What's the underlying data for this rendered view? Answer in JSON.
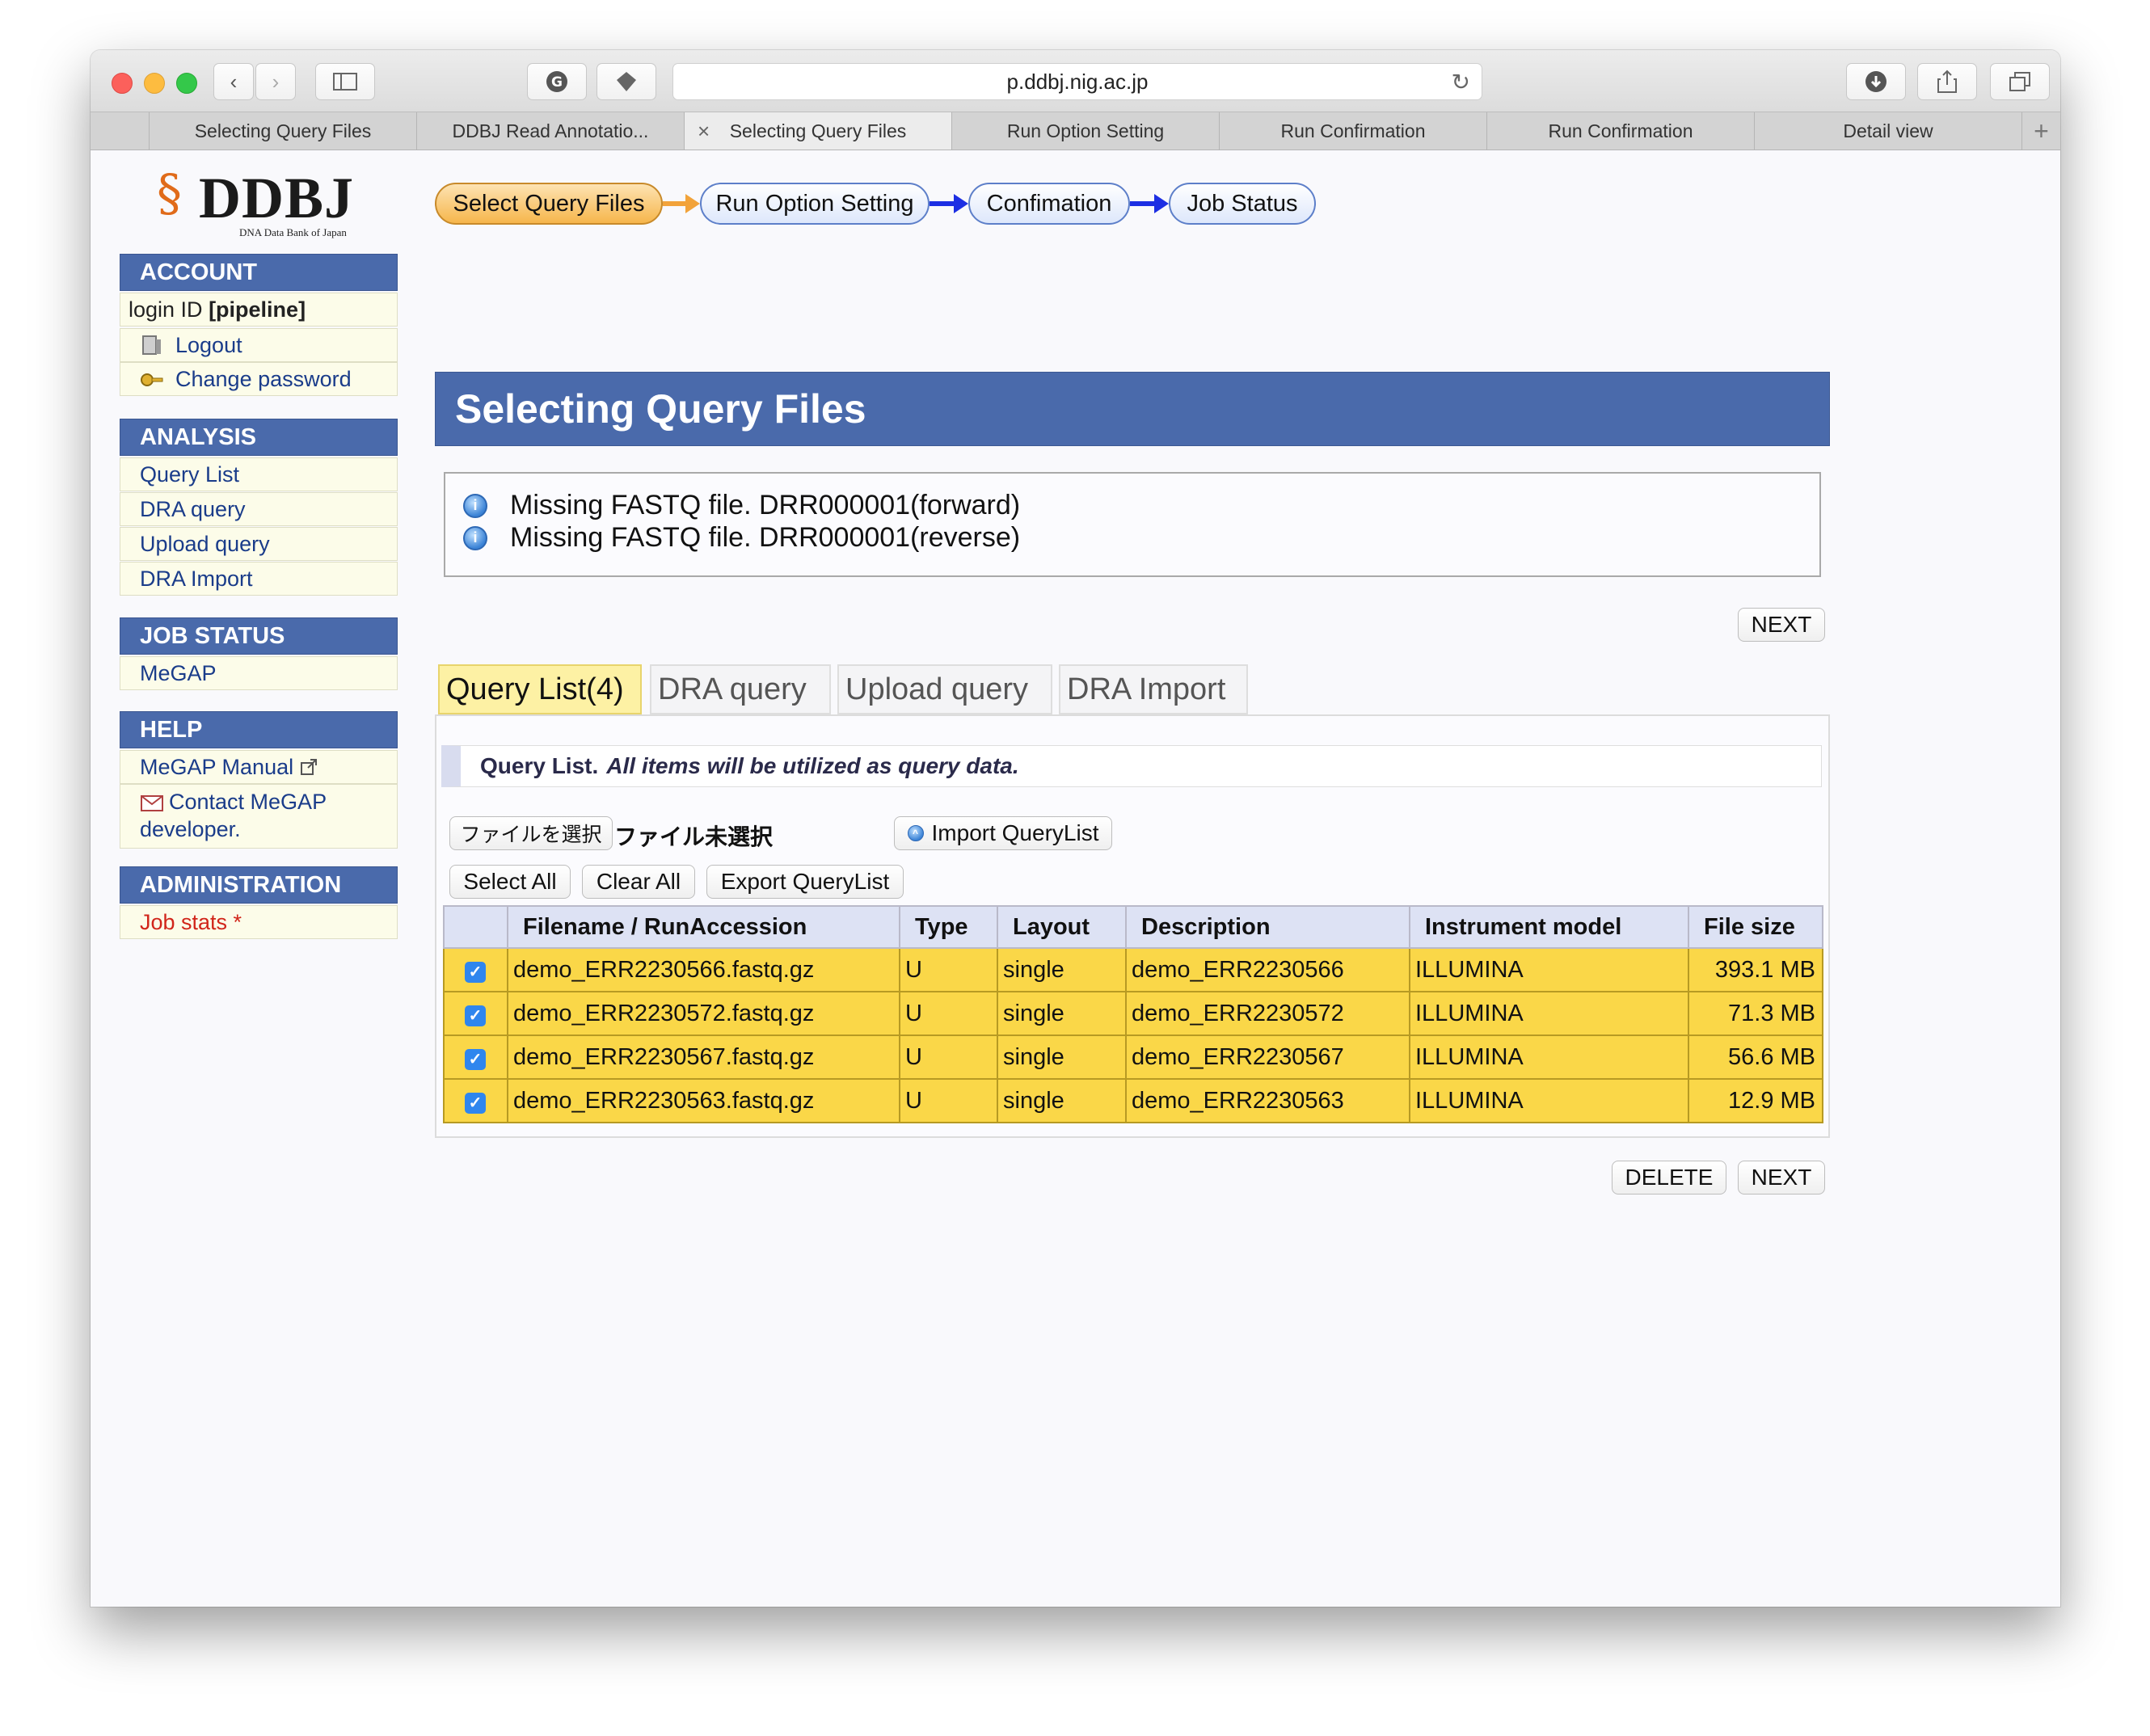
{
  "browser": {
    "url": "p.ddbj.nig.ac.jp",
    "tabs": [
      {
        "label": "Selecting Query Files",
        "active": false
      },
      {
        "label": "DDBJ Read Annotatio...",
        "active": false
      },
      {
        "label": "Selecting Query Files",
        "active": true
      },
      {
        "label": "Run Option Setting",
        "active": false
      },
      {
        "label": "Run Confirmation",
        "active": false
      },
      {
        "label": "Run Confirmation",
        "active": false
      },
      {
        "label": "Detail view",
        "active": false
      }
    ]
  },
  "logo": {
    "text": "DDBJ",
    "subtitle": "DNA Data Bank of Japan"
  },
  "sidebar": {
    "account_head": "ACCOUNT",
    "login_prefix": "login ID ",
    "login_id": "[pipeline]",
    "logout": "Logout",
    "change_password": "Change password",
    "analysis_head": "ANALYSIS",
    "analysis_items": [
      "Query List",
      "DRA query",
      "Upload query",
      "DRA Import"
    ],
    "job_status_head": "JOB STATUS",
    "megap": "MeGAP",
    "help_head": "HELP",
    "manual": "MeGAP Manual",
    "contact_line1": "Contact MeGAP",
    "contact_line2": "developer.",
    "admin_head": "ADMINISTRATION",
    "job_stats": "Job stats *"
  },
  "steps": [
    "Select Query Files",
    "Run Option Setting",
    "Confimation",
    "Job Status"
  ],
  "page_title": "Selecting Query Files",
  "messages": [
    "Missing FASTQ file. DRR000001(forward)",
    "Missing FASTQ file. DRR000001(reverse)"
  ],
  "buttons": {
    "next": "NEXT",
    "delete": "DELETE",
    "choose_file": "ファイルを選択",
    "no_file": "ファイル未選択",
    "import_querylist": "Import QueryList",
    "select_all": "Select All",
    "clear_all": "Clear All",
    "export_querylist": "Export QueryList"
  },
  "query_tabs": [
    "Query List(4)",
    "DRA query",
    "Upload query",
    "DRA Import"
  ],
  "note": {
    "bold": "Query List.",
    "italic": "All items will be utilized as query data."
  },
  "table": {
    "headers": [
      "Filename / RunAccession",
      "Type",
      "Layout",
      "Description",
      "Instrument model",
      "File size"
    ],
    "rows": [
      {
        "checked": true,
        "filename": "demo_ERR2230566.fastq.gz",
        "type": "U",
        "layout": "single",
        "description": "demo_ERR2230566",
        "instrument": "ILLUMINA",
        "size": "393.1 MB"
      },
      {
        "checked": true,
        "filename": "demo_ERR2230572.fastq.gz",
        "type": "U",
        "layout": "single",
        "description": "demo_ERR2230572",
        "instrument": "ILLUMINA",
        "size": "71.3 MB"
      },
      {
        "checked": true,
        "filename": "demo_ERR2230567.fastq.gz",
        "type": "U",
        "layout": "single",
        "description": "demo_ERR2230567",
        "instrument": "ILLUMINA",
        "size": "56.6 MB"
      },
      {
        "checked": true,
        "filename": "demo_ERR2230563.fastq.gz",
        "type": "U",
        "layout": "single",
        "description": "demo_ERR2230563",
        "instrument": "ILLUMINA",
        "size": "12.9 MB"
      }
    ]
  }
}
